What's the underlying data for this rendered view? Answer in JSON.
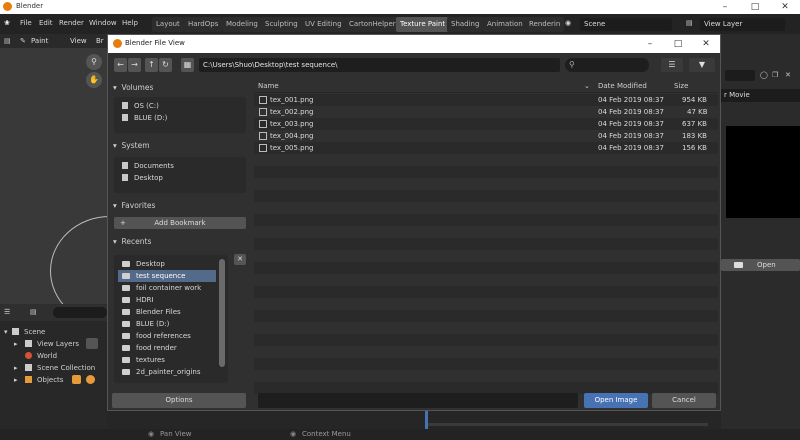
{
  "os_window": {
    "title": "Blender"
  },
  "topbar": {
    "menus": [
      "File",
      "Edit",
      "Render",
      "Window",
      "Help"
    ],
    "workspaces": [
      "Layout",
      "HardOps",
      "Modeling",
      "Sculpting",
      "UV Editing",
      "CartonHelper",
      "Texture Paint",
      "Shading",
      "Animation",
      "Renderin"
    ],
    "active_workspace": "Texture Paint",
    "scene": "Scene",
    "view_layer": "View Layer"
  },
  "viewport_header": {
    "paint": "Paint",
    "view": "View",
    "br": "Br"
  },
  "outliner": {
    "items": [
      "Scene",
      "View Layers",
      "World",
      "Scene Collection",
      "Objects"
    ]
  },
  "right_panel": {
    "for_movie": "r Movie",
    "open": "Open"
  },
  "dialog": {
    "title": "Blender File View",
    "path": "C:\\Users\\Shuo\\Desktop\\test sequence\\",
    "volumes_header": "Volumes",
    "volumes": [
      "OS (C:)",
      "BLUE (D:)"
    ],
    "system_header": "System",
    "system": [
      "Documents",
      "Desktop"
    ],
    "favorites_header": "Favorites",
    "add_bookmark": "Add Bookmark",
    "recents_header": "Recents",
    "recents": [
      "Desktop",
      "test sequence",
      "foil container work",
      "HDRI",
      "Blender Files",
      "BLUE (D:)",
      "food references",
      "food render",
      "textures",
      "2d_painter_origins"
    ],
    "selected_recent": "test sequence",
    "columns": {
      "name": "Name",
      "date": "Date Modified",
      "size": "Size"
    },
    "files": [
      {
        "name": "tex_001.png",
        "date": "04 Feb 2019 08:37",
        "size": "954 KB"
      },
      {
        "name": "tex_002.png",
        "date": "04 Feb 2019 08:37",
        "size": "47 KB"
      },
      {
        "name": "tex_003.png",
        "date": "04 Feb 2019 08:37",
        "size": "637 KB"
      },
      {
        "name": "tex_004.png",
        "date": "04 Feb 2019 08:37",
        "size": "183 KB"
      },
      {
        "name": "tex_005.png",
        "date": "04 Feb 2019 08:37",
        "size": "156 KB"
      }
    ],
    "options_button": "Options",
    "open_button": "Open Image",
    "cancel_button": "Cancel"
  },
  "status": {
    "left": "Pan View",
    "mid": "Context Menu"
  }
}
